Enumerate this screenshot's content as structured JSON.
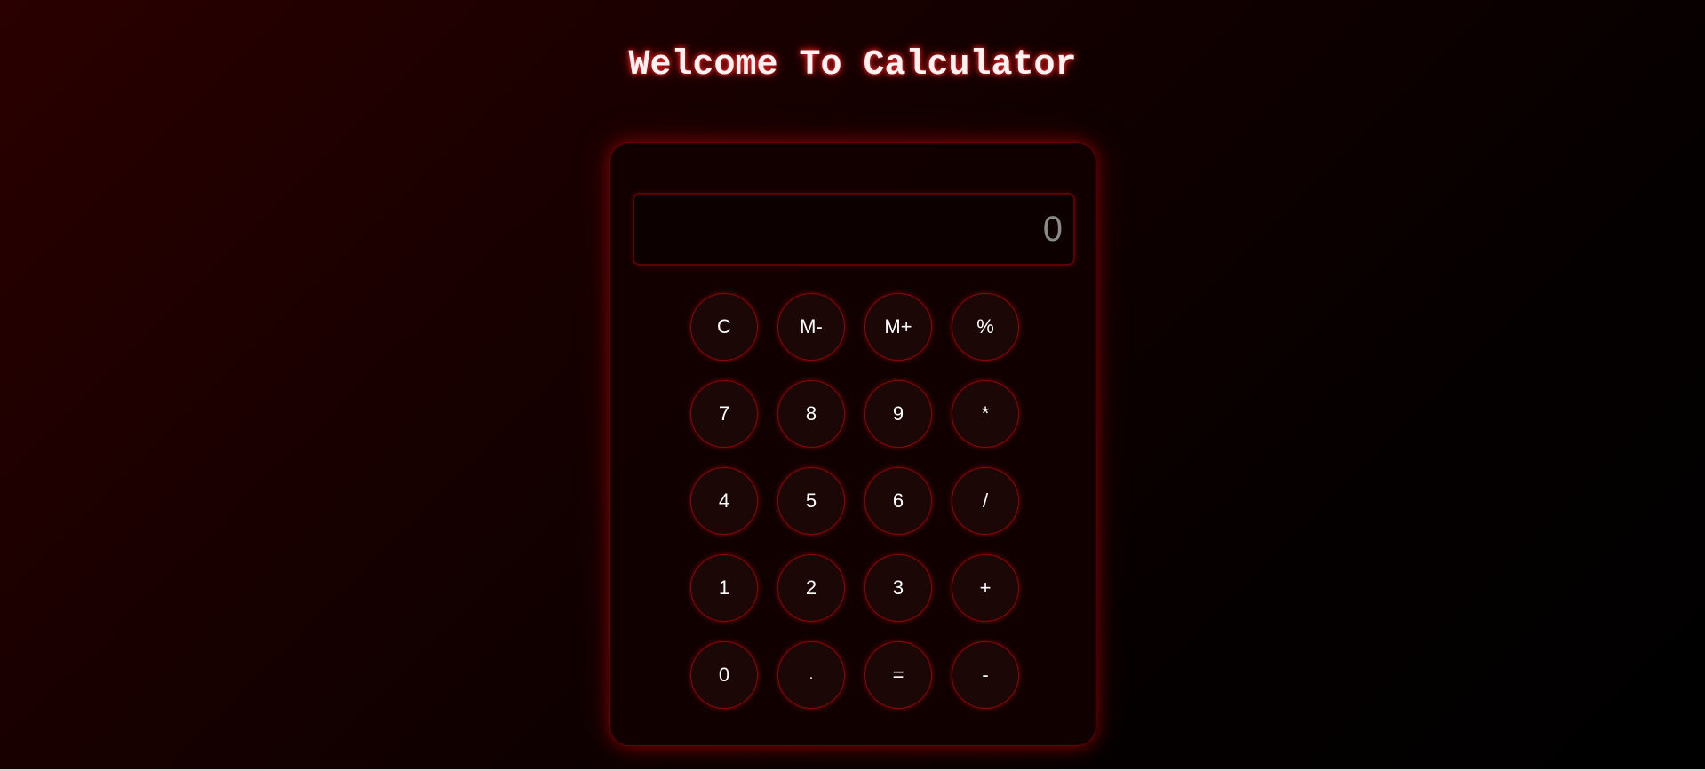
{
  "page": {
    "title": "Welcome To Calculator"
  },
  "display": {
    "value": "0"
  },
  "keypad": {
    "rows": [
      [
        "C",
        "M-",
        "M+",
        "%"
      ],
      [
        "7",
        "8",
        "9",
        "*"
      ],
      [
        "4",
        "5",
        "6",
        "/"
      ],
      [
        "1",
        "2",
        "3",
        "+"
      ],
      [
        "0",
        ".",
        "=",
        "-"
      ]
    ]
  },
  "colors": {
    "accent": "#b00000",
    "key_border": "#8a0606",
    "key_fill": "#1c0707",
    "display_text": "#8a8a8a"
  }
}
